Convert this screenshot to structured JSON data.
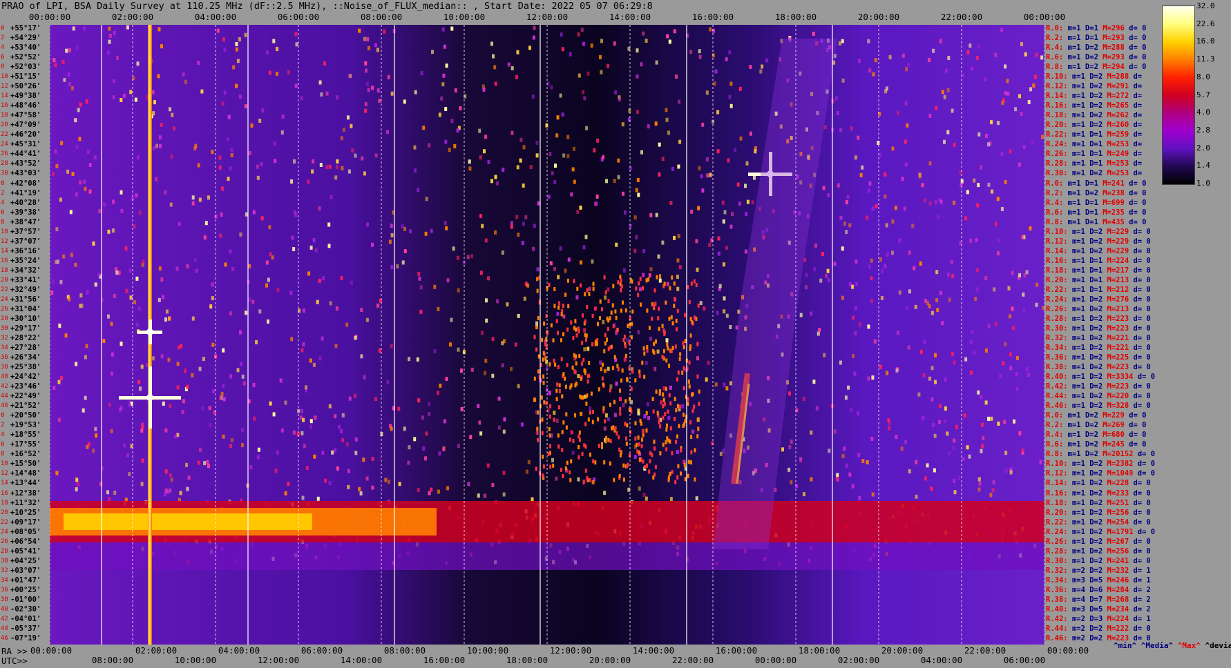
{
  "title": "PRAO of LPI, BSA Daily Survey at 110.25 MHz (dF::2.5 MHz), ::Noise_of_FLUX_median:: , Start Date: 2022 05 07 06:29:8",
  "top_axis_labels": [
    "00:00:00",
    "02:00:00",
    "04:00:00",
    "06:00:00",
    "08:00:00",
    "10:00:00",
    "12:00:00",
    "14:00:00",
    "16:00:00",
    "18:00:00",
    "20:00:00",
    "22:00:00",
    "00:00:00"
  ],
  "ra_axis": {
    "prefix": "RA >>",
    "labels": [
      "00:00:00",
      "02:00:00",
      "04:00:00",
      "06:00:00",
      "08:00:00",
      "10:00:00",
      "12:00:00",
      "14:00:00",
      "16:00:00",
      "18:00:00",
      "20:00:00",
      "22:00:00",
      "00:00:00"
    ]
  },
  "utc_axis": {
    "prefix": "UTC>>",
    "labels": [
      "08:00:00",
      "10:00:00",
      "12:00:00",
      "14:00:00",
      "16:00:00",
      "18:00:00",
      "20:00:00",
      "22:00:00",
      "00:00:00",
      "02:00:00",
      "04:00:00",
      "06:00:00"
    ]
  },
  "row_indices": [
    "0",
    "2",
    "4",
    "6",
    "8",
    "10",
    "12",
    "14",
    "16",
    "18",
    "20",
    "22",
    "24",
    "26",
    "28",
    "30",
    "0",
    "2",
    "4",
    "6",
    "8",
    "10",
    "12",
    "14",
    "16",
    "18",
    "20",
    "22",
    "24",
    "26",
    "28",
    "30",
    "32",
    "34",
    "36",
    "38",
    "40",
    "42",
    "44",
    "46",
    "0",
    "2",
    "4",
    "6",
    "8",
    "10",
    "12",
    "14",
    "16",
    "18",
    "20",
    "22",
    "24",
    "26",
    "28",
    "30",
    "32",
    "34",
    "36",
    "38",
    "40",
    "42",
    "44",
    "46"
  ],
  "declinations": [
    "+55°17'",
    "+54°29'",
    "+53°40'",
    "+52°52'",
    "+52°03'",
    "+51°15'",
    "+50°26'",
    "+49°38'",
    "+48°46'",
    "+47°58'",
    "+47°09'",
    "+46°20'",
    "+45°31'",
    "+44°41'",
    "+43°52'",
    "+43°03'",
    "+42°08'",
    "+41°19'",
    "+40°28'",
    "+39°38'",
    "+38°47'",
    "+37°57'",
    "+37°07'",
    "+36°16'",
    "+35°24'",
    "+34°32'",
    "+33°41'",
    "+32°49'",
    "+31°56'",
    "+31°04'",
    "+30°10'",
    "+29°17'",
    "+28°22'",
    "+27°28'",
    "+26°34'",
    "+25°38'",
    "+24°42'",
    "+23°46'",
    "+22°49'",
    "+21°52'",
    "+20°50'",
    "+19°53'",
    "+18°55'",
    "+17°55'",
    "+16°52'",
    "+15°50'",
    "+14°48'",
    "+13°44'",
    "+12°38'",
    "+11°32'",
    "+10°25'",
    "+09°17'",
    "+08°05'",
    "+06°54'",
    "+05°41'",
    "+04°25'",
    "+03°07'",
    "+01°47'",
    "+00°25'",
    "-01°00'",
    "-02°30'",
    "-04°01'",
    "-05°37'",
    "-07°19'"
  ],
  "stats": [
    {
      "r": "R.0:",
      "m": "m=1",
      "d": "D=1",
      "M": "M=296",
      "dev": "d= 0"
    },
    {
      "r": "R.2:",
      "m": "m=1",
      "d": "D=1",
      "M": "M=293",
      "dev": "d= 0"
    },
    {
      "r": "R.4:",
      "m": "m=1",
      "d": "D=2",
      "M": "M=288",
      "dev": "d= 0"
    },
    {
      "r": "R.6:",
      "m": "m=1",
      "d": "D=2",
      "M": "M=293",
      "dev": "d= 0"
    },
    {
      "r": "R.8:",
      "m": "m=1",
      "d": "D=2",
      "M": "M=294",
      "dev": "d= 0"
    },
    {
      "r": "R.10:",
      "m": "m=1",
      "d": "D=2",
      "M": "M=288",
      "dev": "d="
    },
    {
      "r": "R.12:",
      "m": "m=1",
      "d": "D=2",
      "M": "M=291",
      "dev": "d="
    },
    {
      "r": "R.14:",
      "m": "m=1",
      "d": "D=2",
      "M": "M=272",
      "dev": "d="
    },
    {
      "r": "R.16:",
      "m": "m=1",
      "d": "D=2",
      "M": "M=265",
      "dev": "d="
    },
    {
      "r": "R.18:",
      "m": "m=1",
      "d": "D=2",
      "M": "M=262",
      "dev": "d="
    },
    {
      "r": "R.20:",
      "m": "m=1",
      "d": "D=2",
      "M": "M=260",
      "dev": "d="
    },
    {
      "r": "R.22:",
      "m": "m=1",
      "d": "D=1",
      "M": "M=259",
      "dev": "d="
    },
    {
      "r": "R.24:",
      "m": "m=1",
      "d": "D=1",
      "M": "M=253",
      "dev": "d="
    },
    {
      "r": "R.26:",
      "m": "m=1",
      "d": "D=1",
      "M": "M=249",
      "dev": "d="
    },
    {
      "r": "R.28:",
      "m": "m=1",
      "d": "D=1",
      "M": "M=253",
      "dev": "d="
    },
    {
      "r": "R.30:",
      "m": "m=1",
      "d": "D=2",
      "M": "M=253",
      "dev": "d="
    },
    {
      "r": "R.0:",
      "m": "m=1",
      "d": "D=1",
      "M": "M=241",
      "dev": "d= 0"
    },
    {
      "r": "R.2:",
      "m": "m=1",
      "d": "D=2",
      "M": "M=238",
      "dev": "d= 0"
    },
    {
      "r": "R.4:",
      "m": "m=1",
      "d": "D=1",
      "M": "M=699",
      "dev": "d= 0"
    },
    {
      "r": "R.6:",
      "m": "m=1",
      "d": "D=1",
      "M": "M=235",
      "dev": "d= 0"
    },
    {
      "r": "R.8:",
      "m": "m=1",
      "d": "D=1",
      "M": "M=435",
      "dev": "d= 0"
    },
    {
      "r": "R.10:",
      "m": "m=1",
      "d": "D=2",
      "M": "M=229",
      "dev": "d= 0"
    },
    {
      "r": "R.12:",
      "m": "m=1",
      "d": "D=2",
      "M": "M=229",
      "dev": "d= 0"
    },
    {
      "r": "R.14:",
      "m": "m=1",
      "d": "D=2",
      "M": "M=229",
      "dev": "d= 0"
    },
    {
      "r": "R.16:",
      "m": "m=1",
      "d": "D=1",
      "M": "M=224",
      "dev": "d= 0"
    },
    {
      "r": "R.18:",
      "m": "m=1",
      "d": "D=1",
      "M": "M=217",
      "dev": "d= 0"
    },
    {
      "r": "R.20:",
      "m": "m=1",
      "d": "D=1",
      "M": "M=213",
      "dev": "d= 0"
    },
    {
      "r": "R.22:",
      "m": "m=1",
      "d": "D=1",
      "M": "M=212",
      "dev": "d= 0"
    },
    {
      "r": "R.24:",
      "m": "m=1",
      "d": "D=2",
      "M": "M=276",
      "dev": "d= 0"
    },
    {
      "r": "R.26:",
      "m": "m=1",
      "d": "D=2",
      "M": "M=213",
      "dev": "d= 0"
    },
    {
      "r": "R.28:",
      "m": "m=1",
      "d": "D=2",
      "M": "M=223",
      "dev": "d= 0"
    },
    {
      "r": "R.30:",
      "m": "m=1",
      "d": "D=2",
      "M": "M=223",
      "dev": "d= 0"
    },
    {
      "r": "R.32:",
      "m": "m=1",
      "d": "D=2",
      "M": "M=221",
      "dev": "d= 0"
    },
    {
      "r": "R.34:",
      "m": "m=1",
      "d": "D=2",
      "M": "M=221",
      "dev": "d= 0"
    },
    {
      "r": "R.36:",
      "m": "m=1",
      "d": "D=2",
      "M": "M=225",
      "dev": "d= 0"
    },
    {
      "r": "R.38:",
      "m": "m=1",
      "d": "D=2",
      "M": "M=223",
      "dev": "d= 0"
    },
    {
      "r": "R.40:",
      "m": "m=1",
      "d": "D=2",
      "M": "M=3334",
      "dev": "d= 0"
    },
    {
      "r": "R.42:",
      "m": "m=1",
      "d": "D=2",
      "M": "M=223",
      "dev": "d= 0"
    },
    {
      "r": "R.44:",
      "m": "m=1",
      "d": "D=2",
      "M": "M=220",
      "dev": "d= 0"
    },
    {
      "r": "R.46:",
      "m": "m=1",
      "d": "D=2",
      "M": "M=328",
      "dev": "d= 0"
    },
    {
      "r": "R.0:",
      "m": "m=1",
      "d": "D=2",
      "M": "M=229",
      "dev": "d= 0"
    },
    {
      "r": "R.2:",
      "m": "m=1",
      "d": "D=2",
      "M": "M=269",
      "dev": "d= 0"
    },
    {
      "r": "R.4:",
      "m": "m=1",
      "d": "D=2",
      "M": "M=680",
      "dev": "d= 0"
    },
    {
      "r": "R.6:",
      "m": "m=1",
      "d": "D=2",
      "M": "M=245",
      "dev": "d= 0"
    },
    {
      "r": "R.8:",
      "m": "m=1",
      "d": "D=2",
      "M": "M=20152",
      "dev": "d= 0"
    },
    {
      "r": "R.10:",
      "m": "m=1",
      "d": "D=2",
      "M": "M=2382",
      "dev": "d= 0"
    },
    {
      "r": "R.12:",
      "m": "m=1",
      "d": "D=2",
      "M": "M=1049",
      "dev": "d= 0"
    },
    {
      "r": "R.14:",
      "m": "m=1",
      "d": "D=2",
      "M": "M=228",
      "dev": "d= 0"
    },
    {
      "r": "R.16:",
      "m": "m=1",
      "d": "D=2",
      "M": "M=233",
      "dev": "d= 0"
    },
    {
      "r": "R.18:",
      "m": "m=1",
      "d": "D=2",
      "M": "M=251",
      "dev": "d= 0"
    },
    {
      "r": "R.20:",
      "m": "m=1",
      "d": "D=2",
      "M": "M=256",
      "dev": "d= 0"
    },
    {
      "r": "R.22:",
      "m": "m=1",
      "d": "D=2",
      "M": "M=254",
      "dev": "d= 0"
    },
    {
      "r": "R.24:",
      "m": "m=1",
      "d": "D=2",
      "M": "M=1791",
      "dev": "d= 0"
    },
    {
      "r": "R.26:",
      "m": "m=1",
      "d": "D=2",
      "M": "M=267",
      "dev": "d= 0"
    },
    {
      "r": "R.28:",
      "m": "m=1",
      "d": "D=2",
      "M": "M=256",
      "dev": "d= 0"
    },
    {
      "r": "R.30:",
      "m": "m=1",
      "d": "D=2",
      "M": "M=241",
      "dev": "d= 0"
    },
    {
      "r": "R.32:",
      "m": "m=2",
      "d": "D=2",
      "M": "M=232",
      "dev": "d= 1"
    },
    {
      "r": "R.34:",
      "m": "m=3",
      "d": "D=5",
      "M": "M=246",
      "dev": "d= 1"
    },
    {
      "r": "R.36:",
      "m": "m=4",
      "d": "D=6",
      "M": "M=284",
      "dev": "d= 2"
    },
    {
      "r": "R.38:",
      "m": "m=4",
      "d": "D=7",
      "M": "M=268",
      "dev": "d= 2"
    },
    {
      "r": "R.40:",
      "m": "m=3",
      "d": "D=5",
      "M": "M=234",
      "dev": "d= 2"
    },
    {
      "r": "R.42:",
      "m": "m=2",
      "d": "D=3",
      "M": "M=224",
      "dev": "d= 1"
    },
    {
      "r": "R.44:",
      "m": "m=2",
      "d": "D=2",
      "M": "M=222",
      "dev": "d= 0"
    },
    {
      "r": "R.46:",
      "m": "m=2",
      "d": "D=2",
      "M": "M=223",
      "dev": "d= 0"
    }
  ],
  "colorbar": {
    "ticks": [
      "32.0",
      "22.6",
      "16.0",
      "11.3",
      "8.0",
      "5.7",
      "4.0",
      "2.8",
      "2.0",
      "1.4",
      "1.0"
    ],
    "colors": [
      "#fffff0",
      "#ffff80",
      "#ffd000",
      "#ff8000",
      "#ff2000",
      "#d00020",
      "#b00080",
      "#a000d0",
      "#6010c0",
      "#200850",
      "#000000"
    ]
  },
  "legend": {
    "min": "^min^",
    "median": "^Media^",
    "max": "^Max^",
    "dev": "^devia^"
  }
}
